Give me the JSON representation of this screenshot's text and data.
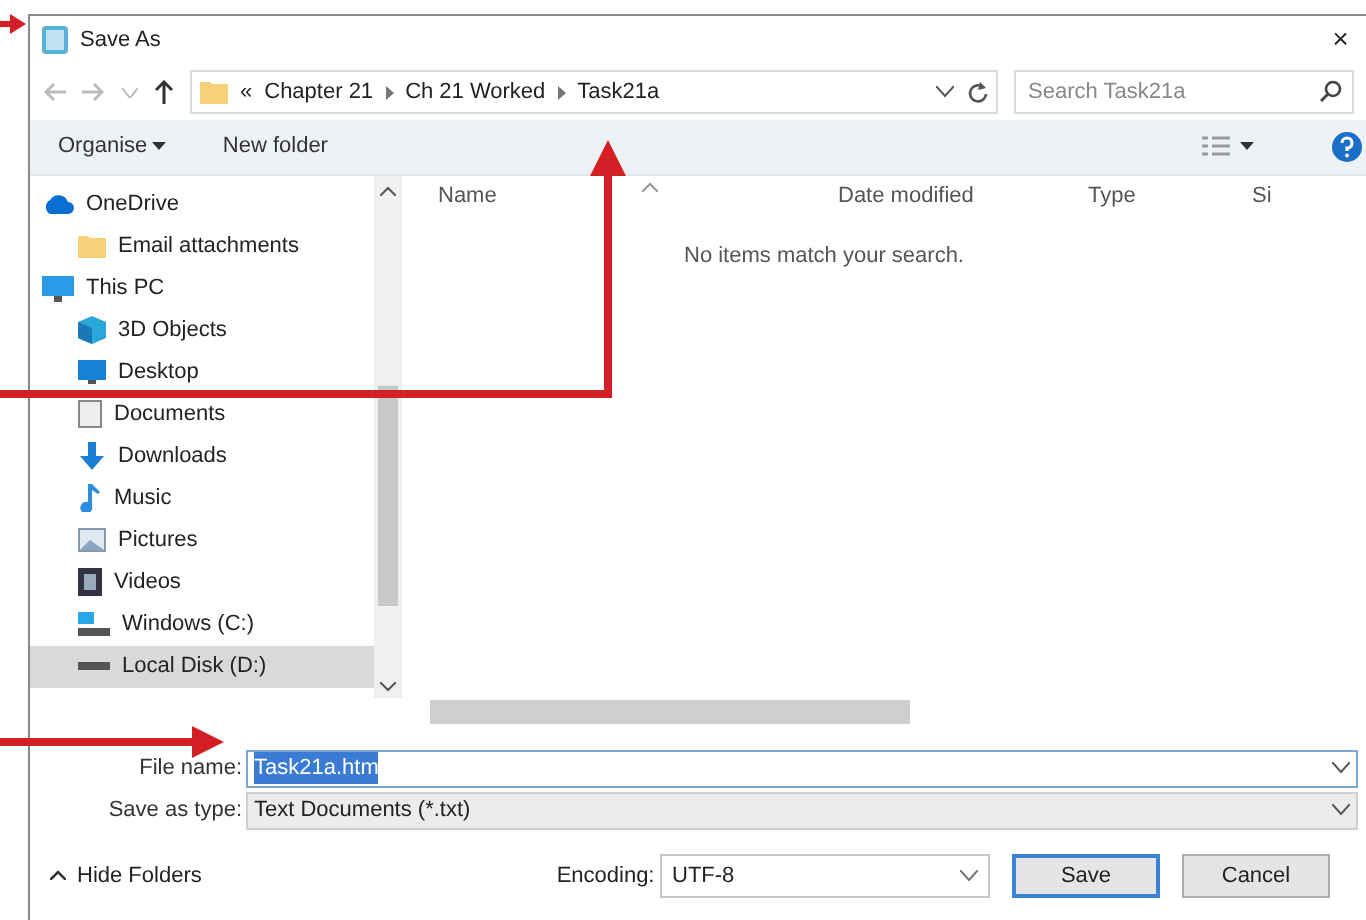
{
  "window": {
    "title": "Save As",
    "close": "×"
  },
  "address": {
    "overflow": "«",
    "crumbs": [
      "Chapter 21",
      "Ch 21 Worked",
      "Task21a"
    ],
    "search_placeholder": "Search Task21a"
  },
  "toolbar": {
    "organise": "Organise",
    "new_folder": "New folder"
  },
  "nav": [
    {
      "label": "OneDrive",
      "kind": "cloud",
      "selected": false,
      "children": [
        {
          "label": "Email attachments",
          "kind": "folder",
          "selected": false
        }
      ]
    },
    {
      "label": "This PC",
      "kind": "pc",
      "selected": false,
      "children": [
        {
          "label": "3D Objects",
          "kind": "cube",
          "selected": false
        },
        {
          "label": "Desktop",
          "kind": "desktop",
          "selected": false
        },
        {
          "label": "Documents",
          "kind": "doc",
          "selected": false
        },
        {
          "label": "Downloads",
          "kind": "download",
          "selected": false
        },
        {
          "label": "Music",
          "kind": "music",
          "selected": false
        },
        {
          "label": "Pictures",
          "kind": "picture",
          "selected": false
        },
        {
          "label": "Videos",
          "kind": "video",
          "selected": false
        },
        {
          "label": "Windows (C:)",
          "kind": "drive",
          "selected": false
        },
        {
          "label": "Local Disk (D:)",
          "kind": "disk",
          "selected": true
        }
      ]
    }
  ],
  "table": {
    "columns": [
      "Name",
      "Date modified",
      "Type",
      "Si"
    ],
    "empty_message": "No items match your search."
  },
  "form": {
    "file_name_label": "File name:",
    "file_name": "Task21a.htm",
    "type_label": "Save as type:",
    "type": "Text Documents (*.txt)"
  },
  "footer": {
    "hide_folders": "Hide Folders",
    "encoding_label": "Encoding:",
    "encoding": "UTF-8",
    "buttons": [
      {
        "label": "Save",
        "default": true
      },
      {
        "label": "Cancel",
        "default": false
      }
    ]
  }
}
